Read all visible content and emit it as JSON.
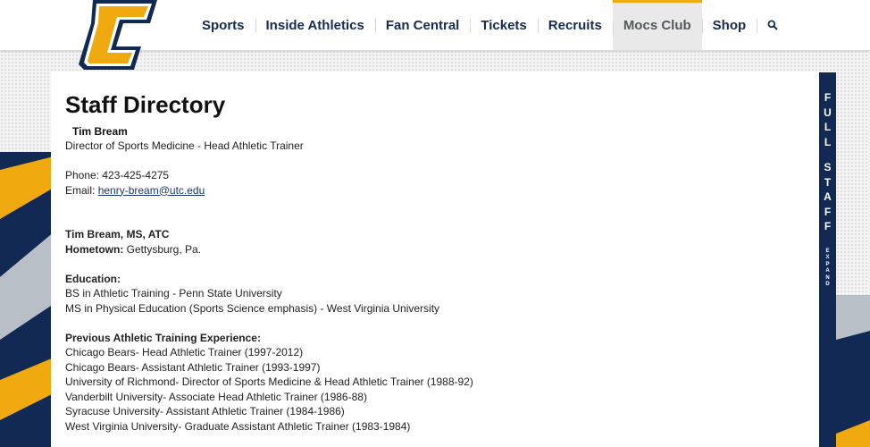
{
  "nav": {
    "items": [
      {
        "label": "Sports"
      },
      {
        "label": "Inside Athletics"
      },
      {
        "label": "Fan Central"
      },
      {
        "label": "Tickets"
      },
      {
        "label": "Recruits"
      },
      {
        "label": "Mocs Club"
      },
      {
        "label": "Shop"
      }
    ],
    "search_icon": "search-icon"
  },
  "logo": {
    "icon": "utc-c-logo",
    "colors": {
      "gold": "#f0a90e",
      "navy": "#122a53"
    }
  },
  "page": {
    "title": "Staff Directory"
  },
  "staff": {
    "name": "Tim Bream",
    "position": "Director of Sports Medicine - Head Athletic Trainer",
    "phone_line": "Phone: 423-425-4275",
    "email_label": "Email: ",
    "email": "henry-bream@utc.edu"
  },
  "bio": {
    "name_line": "Tim Bream, MS, ATC",
    "hometown_label": "Hometown:",
    "hometown": " Gettysburg, Pa.",
    "education_heading": "Education:",
    "education": [
      "BS in Athletic Training - Penn State University",
      "MS in Physical Education (Sports Science emphasis) - West Virginia University"
    ],
    "experience_heading": "Previous Athletic Training Experience:",
    "experience": [
      "Chicago Bears- Head Athletic Trainer (1997-2012)",
      "Chicago Bears- Assistant Athletic Trainer (1993-1997)",
      "University of Richmond- Director of Sports Medicine & Head Athletic Trainer (1988-92)",
      "Vanderbilt University- Associate Head Athletic Trainer (1986-88)",
      "Syracuse University- Assistant Athletic Trainer (1984-1986)",
      "West Virginia University- Graduate Assistant Athletic Trainer (1983-1984)"
    ]
  },
  "side_tab": {
    "word1": [
      "F",
      "U",
      "L",
      "L"
    ],
    "word2": [
      "S",
      "T",
      "A",
      "F",
      "F"
    ],
    "expand": [
      "E",
      "X",
      "P",
      "A",
      "N",
      "D"
    ]
  },
  "colors": {
    "navy": "#122a53",
    "gold": "#f0a90e",
    "gray": "#b9bfc6"
  }
}
